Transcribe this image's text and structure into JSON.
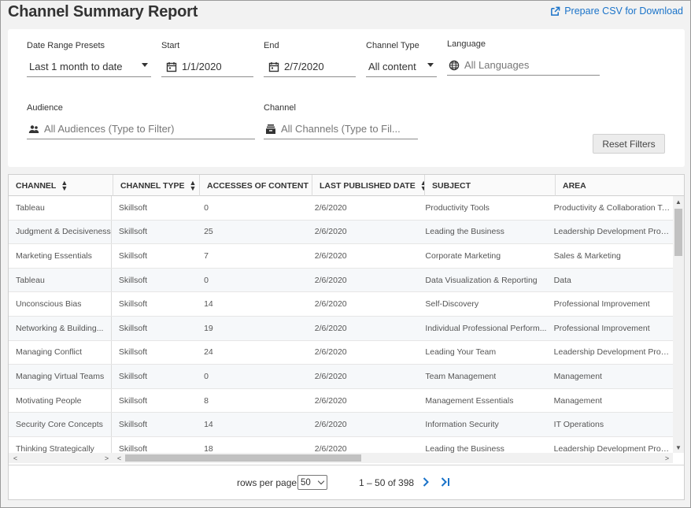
{
  "header": {
    "title": "Channel Summary Report",
    "csv_link": "Prepare CSV for Download"
  },
  "filters": {
    "date_range": {
      "label": "Date Range Presets",
      "value": "Last 1 month to date"
    },
    "start": {
      "label": "Start",
      "value": "1/1/2020"
    },
    "end": {
      "label": "End",
      "value": "2/7/2020"
    },
    "channel_type": {
      "label": "Channel Type",
      "value": "All content"
    },
    "language": {
      "label": "Language",
      "placeholder": "All Languages"
    },
    "audience": {
      "label": "Audience",
      "placeholder": "All Audiences (Type to Filter)"
    },
    "channel": {
      "label": "Channel",
      "placeholder": "All Channels (Type to Fil..."
    },
    "reset_label": "Reset Filters"
  },
  "table": {
    "columns": [
      "CHANNEL",
      "CHANNEL TYPE",
      "ACCESSES OF CONTENT",
      "LAST PUBLISHED DATE",
      "SUBJECT",
      "AREA"
    ],
    "rows": [
      [
        "Tableau",
        "Skillsoft",
        "0",
        "2/6/2020",
        "Productivity Tools",
        "Productivity & Collaboration To..."
      ],
      [
        "Judgment & Decisiveness",
        "Skillsoft",
        "25",
        "2/6/2020",
        "Leading the Business",
        "Leadership Development Progr..."
      ],
      [
        "Marketing Essentials",
        "Skillsoft",
        "7",
        "2/6/2020",
        "Corporate Marketing",
        "Sales & Marketing"
      ],
      [
        "Tableau",
        "Skillsoft",
        "0",
        "2/6/2020",
        "Data Visualization & Reporting",
        "Data"
      ],
      [
        "Unconscious Bias",
        "Skillsoft",
        "14",
        "2/6/2020",
        "Self-Discovery",
        "Professional Improvement"
      ],
      [
        "Networking & Building...",
        "Skillsoft",
        "19",
        "2/6/2020",
        "Individual Professional Perform...",
        "Professional Improvement"
      ],
      [
        "Managing Conflict",
        "Skillsoft",
        "24",
        "2/6/2020",
        "Leading Your Team",
        "Leadership Development Progr..."
      ],
      [
        "Managing Virtual Teams",
        "Skillsoft",
        "0",
        "2/6/2020",
        "Team Management",
        "Management"
      ],
      [
        "Motivating People",
        "Skillsoft",
        "8",
        "2/6/2020",
        "Management Essentials",
        "Management"
      ],
      [
        "Security Core Concepts",
        "Skillsoft",
        "14",
        "2/6/2020",
        "Information Security",
        "IT Operations"
      ],
      [
        "Thinking Strategically",
        "Skillsoft",
        "18",
        "2/6/2020",
        "Leading the Business",
        "Leadership Development Progr..."
      ]
    ]
  },
  "pagination": {
    "rows_per_page_label": "rows per page",
    "rows_per_page_value": "50",
    "range_text": "1 – 50 of 398"
  },
  "colors": {
    "link": "#1a73c9",
    "panel": "#ffffff",
    "background": "#f2f2f2"
  }
}
